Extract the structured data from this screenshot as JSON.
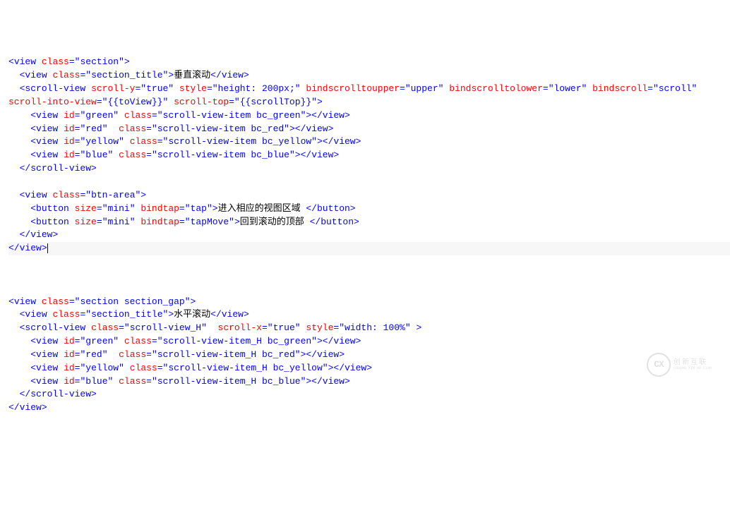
{
  "code": {
    "color_tag": "#0000ff",
    "color_attr": "#ff0000",
    "color_val": "#0000ff",
    "color_txt": "#000000",
    "section1": {
      "open_view": "view",
      "open_view_class_attr": "class",
      "open_view_class_val": "\"section\"",
      "title_view": "view",
      "title_class_attr": "class",
      "title_class_val": "\"section_title\"",
      "title_text": "垂直滚动",
      "scrollview_tag": "scroll-view",
      "scrolly_attr": "scroll-y",
      "scrolly_val": "\"true\"",
      "style_attr": "style",
      "style_val": "\"height: 200px;\"",
      "bstu_attr": "bindscrolltoupper",
      "bstu_val": "\"upper\"",
      "bstl_attr": "bindscrolltolower",
      "bstl_val": "\"lower\"",
      "bs_attr": "bindscroll",
      "bs_val": "\"scroll\"",
      "siv_attr": "scroll-into-view",
      "siv_val": "\"{{toView}}\"",
      "st_attr": "scroll-top",
      "st_val": "\"{{scrollTop}}\"",
      "view_item_tag": "view",
      "id_attr": "id",
      "class_attr": "class",
      "green_id": "\"green\"",
      "green_class": "\"scroll-view-item bc_green\"",
      "red_id": "\"red\"",
      "red_class": "\"scroll-view-item bc_red\"",
      "yellow_id": "\"yellow\"",
      "yellow_class": "\"scroll-view-item bc_yellow\"",
      "blue_id": "\"blue\"",
      "blue_class": "\"scroll-view-item bc_blue\"",
      "btn_area_class": "\"btn-area\"",
      "button_tag": "button",
      "size_attr": "size",
      "size_val": "\"mini\"",
      "bindtap_attr": "bindtap",
      "bindtap_tap": "\"tap\"",
      "bindtap_tapmove": "\"tapMove\"",
      "button1_text": "进入相应的视图区域 ",
      "button2_text": "回到滚动的顶部 "
    },
    "section2": {
      "open_class": "\"section section_gap\"",
      "title_text": "水平滚动",
      "sv_class": "\"scroll-view_H\"",
      "scrollx_attr": "scroll-x",
      "scrollx_val": "\"true\"",
      "style_val": "\"width: 100%\"",
      "green_class": "\"scroll-view-item_H bc_green\"",
      "red_class": "\"scroll-view-item_H bc_red\"",
      "yellow_class": "\"scroll-view-item_H bc_yellow\"",
      "blue_class": "\"scroll-view-item_H bc_blue\""
    }
  },
  "watermark": {
    "letters": "CX",
    "line1": "创新互联",
    "line2": "CHUANG XIN HU LIAN"
  }
}
